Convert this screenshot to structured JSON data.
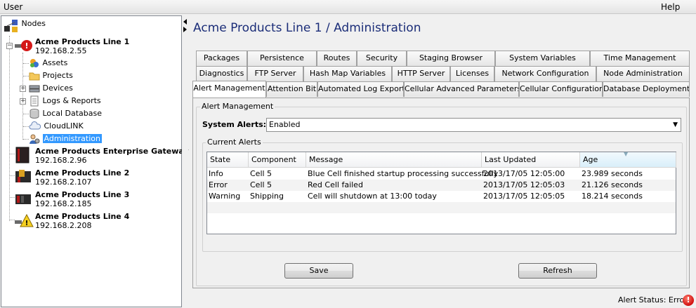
{
  "menu": {
    "user": "User",
    "help": "Help"
  },
  "tree": {
    "root_label": "Nodes",
    "nodes": [
      {
        "name": "Acme Products Line 1",
        "ip": "192.168.2.55",
        "status_icon": "error-badge-icon"
      },
      {
        "name": "Acme Products Enterprise Gateway",
        "ip": "192.168.2.96",
        "status_icon": "none"
      },
      {
        "name": "Acme Products Line 2",
        "ip": "192.168.2.107",
        "status_icon": "none"
      },
      {
        "name": "Acme Products Line 3",
        "ip": "192.168.2.185",
        "status_icon": "none"
      },
      {
        "name": "Acme Products Line 4",
        "ip": "192.168.2.208",
        "status_icon": "warning-badge-icon"
      }
    ],
    "children": [
      "Assets",
      "Projects",
      "Devices",
      "Logs & Reports",
      "Local Database",
      "CloudLINK",
      "Administration"
    ],
    "selected": "Administration"
  },
  "page_title": "Acme Products Line 1 / Administration",
  "tabs": {
    "row1": [
      "Packages",
      "Persistence",
      "Routes",
      "Security",
      "Staging Browser",
      "System Variables",
      "Time Management"
    ],
    "row2": [
      "Diagnostics",
      "FTP Server",
      "Hash Map Variables",
      "HTTP Server",
      "Licenses",
      "Network Configuration",
      "Node Administration"
    ],
    "row3": [
      "Alert Management",
      "Attention Bit",
      "Automated Log Export",
      "Cellular Advanced Parameters",
      "Cellular Configuration",
      "Database Deployment"
    ],
    "active": "Alert Management"
  },
  "panel": {
    "group_title": "Alert Management",
    "system_alerts_label": "System Alerts:",
    "system_alerts_value": "Enabled",
    "current_alerts_title": "Current Alerts",
    "columns": [
      "State",
      "Component",
      "Message",
      "Last Updated",
      "Age"
    ],
    "rows": [
      [
        "Info",
        "Cell 5",
        "Blue Cell finished startup processing successfully",
        "2013/17/05 12:05:00",
        "23.989 seconds"
      ],
      [
        "Error",
        "Cell 5",
        "Red Cell failed",
        "2013/17/05 12:05:03",
        "21.126 seconds"
      ],
      [
        "Warning",
        "Shipping",
        "Cell will shutdown at 13:00 today",
        "2013/17/05 12:05:05",
        "18.214 seconds"
      ]
    ],
    "save_label": "Save",
    "refresh_label": "Refresh"
  },
  "status": {
    "text": "Alert Status: Error",
    "icon": "error-icon"
  }
}
